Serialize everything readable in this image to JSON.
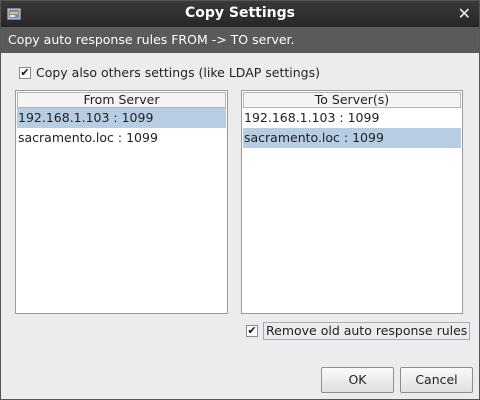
{
  "window": {
    "title": "Copy Settings",
    "close_glyph": "✕"
  },
  "banner": {
    "text": "Copy auto response rules FROM -> TO server."
  },
  "options": {
    "copy_others": {
      "label": "Copy also others settings (like LDAP settings)",
      "checked": true
    },
    "remove_old": {
      "label": "Remove old auto response rules",
      "checked": true
    }
  },
  "from_panel": {
    "header": "From Server",
    "items": [
      {
        "label": "192.168.1.103 : 1099",
        "selected": true
      },
      {
        "label": "sacramento.loc : 1099",
        "selected": false
      }
    ]
  },
  "to_panel": {
    "header": "To Server(s)",
    "items": [
      {
        "label": "192.168.1.103 : 1099",
        "selected": false
      },
      {
        "label": "sacramento.loc : 1099",
        "selected": true
      }
    ]
  },
  "buttons": {
    "ok": "OK",
    "cancel": "Cancel"
  },
  "check_glyph": "✔",
  "colors": {
    "selection": "#b7cde4",
    "titlebar": "#2e2e2e",
    "banner": "#5a5a5a"
  }
}
